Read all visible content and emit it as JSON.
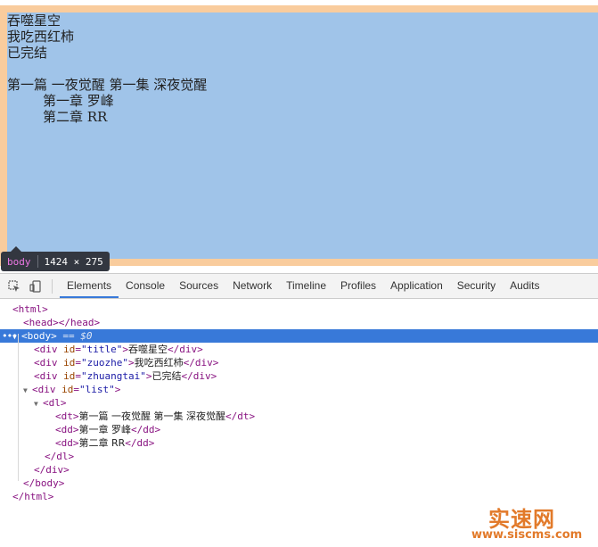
{
  "page": {
    "lines": [
      "吞噬星空",
      "我吃西红柿",
      "已完结"
    ],
    "list_title": "第一篇 一夜觉醒 第一集 深夜觉醒",
    "list_items": [
      "第一章 罗峰",
      "第二章 RR"
    ]
  },
  "tooltip": {
    "tag": "body",
    "size": "1424 × 275"
  },
  "devtools": {
    "tabs": [
      "Elements",
      "Console",
      "Sources",
      "Network",
      "Timeline",
      "Profiles",
      "Application",
      "Security",
      "Audits"
    ],
    "active_tab": "Elements",
    "dom": {
      "html_open": "<html>",
      "head": "<head></head>",
      "body_open": "<body>",
      "body_eq": "== $0",
      "title_id": "\"title\"",
      "title_text": "吞噬星空",
      "zuozhe_id": "\"zuozhe\"",
      "zuozhe_text": "我吃西红柿",
      "zhuangtai_id": "\"zhuangtai\"",
      "zhuangtai_text": "已完结",
      "list_id": "\"list\"",
      "dt_text": "第一篇 一夜觉醒 第一集 深夜觉醒",
      "dd1_text": "第一章 罗峰",
      "dd2_text": "第二章 RR"
    }
  },
  "watermark": {
    "main": "实速网",
    "sub": "www.siscms.com"
  },
  "colors": {
    "margin_overlay": "#f9cc9d",
    "content_overlay": "#a0c4e9",
    "selection": "#3879d9",
    "tag": "#881280",
    "attr_name": "#994500",
    "attr_value": "#1a1aa6",
    "watermark": "#e27a2a"
  }
}
